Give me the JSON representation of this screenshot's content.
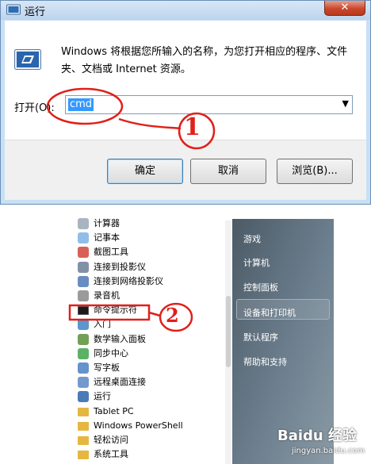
{
  "run_dialog": {
    "title": "运行",
    "close_glyph": "✕",
    "description": "Windows 将根据您所输入的名称，为您打开相应的程序、文件夹、文档或 Internet 资源。",
    "open_label": "打开(O):",
    "command_value": "cmd",
    "dropdown_glyph": "▼",
    "ok_label": "确定",
    "cancel_label": "取消",
    "browse_label": "浏览(B)...",
    "accent": "#3399ff"
  },
  "start_menu": {
    "items": [
      {
        "label": "计算器",
        "icon": "calculator-icon"
      },
      {
        "label": "记事本",
        "icon": "notepad-icon"
      },
      {
        "label": "截图工具",
        "icon": "scissors-icon"
      },
      {
        "label": "连接到投影仪",
        "icon": "projector-icon"
      },
      {
        "label": "连接到网络投影仪",
        "icon": "network-projector-icon"
      },
      {
        "label": "录音机",
        "icon": "microphone-icon"
      },
      {
        "label": "命令提示符",
        "icon": "command-prompt-icon"
      },
      {
        "label": "入门",
        "icon": "getting-started-icon"
      },
      {
        "label": "数学输入面板",
        "icon": "math-input-icon"
      },
      {
        "label": "同步中心",
        "icon": "sync-icon"
      },
      {
        "label": "写字板",
        "icon": "wordpad-icon"
      },
      {
        "label": "远程桌面连接",
        "icon": "remote-desktop-icon"
      },
      {
        "label": "运行",
        "icon": "run-icon"
      },
      {
        "label": "Tablet PC",
        "icon": "folder-icon"
      },
      {
        "label": "Windows PowerShell",
        "icon": "folder-icon"
      },
      {
        "label": "轻松访问",
        "icon": "folder-icon"
      },
      {
        "label": "系统工具",
        "icon": "folder-icon"
      }
    ],
    "right_panel": [
      {
        "label": "游戏"
      },
      {
        "label": "计算机"
      },
      {
        "label": "控制面板"
      },
      {
        "label": "设备和打印机"
      },
      {
        "label": "默认程序"
      },
      {
        "label": "帮助和支持"
      }
    ]
  },
  "annotations": {
    "step1": "1",
    "step2": "2",
    "color": "#e0201a"
  },
  "watermark": {
    "brand": "Baidu 经验",
    "url": "jingyan.baidu.com"
  }
}
